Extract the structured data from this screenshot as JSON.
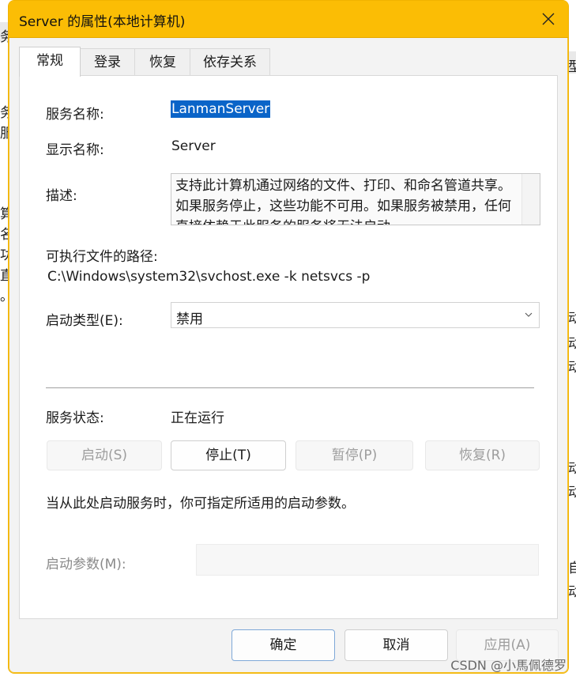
{
  "window": {
    "title": "Server 的属性(本地计算机)",
    "accent_color": "#fbbd05"
  },
  "tabs": [
    {
      "label": "常规",
      "active": true
    },
    {
      "label": "登录",
      "active": false
    },
    {
      "label": "恢复",
      "active": false
    },
    {
      "label": "依存关系",
      "active": false
    }
  ],
  "general": {
    "service_name_label": "服务名称:",
    "service_name_value": "LanmanServer",
    "display_name_label": "显示名称:",
    "display_name_value": "Server",
    "description_label": "描述:",
    "description_text": "支持此计算机通过网络的文件、打印、和命名管道共享。如果服务停止，这些功能不可用。如果服务被禁用，任何直接依赖于此服务的服务将无法启动。",
    "exe_path_label": "可执行文件的路径:",
    "exe_path_value": "C:\\Windows\\system32\\svchost.exe -k netsvcs -p",
    "startup_type_label": "启动类型(E):",
    "startup_type_value": "禁用",
    "service_status_label": "服务状态:",
    "service_status_value": "正在运行",
    "hint_text": "当从此处启动服务时，你可指定所适用的启动参数。",
    "start_params_label": "启动参数(M):"
  },
  "control_buttons": {
    "start": "启动(S)",
    "stop": "停止(T)",
    "pause": "暂停(P)",
    "resume": "恢复(R)"
  },
  "footer_buttons": {
    "ok": "确定",
    "cancel": "取消",
    "apply": "应用(A)"
  },
  "watermark": "CSDN @小馬佩德罗",
  "background_fragments": {
    "left": [
      "务",
      "服",
      "算",
      "名",
      "功",
      "直",
      "。"
    ],
    "right": [
      "型",
      "动",
      "动",
      "动",
      "动",
      "动",
      "自",
      "动"
    ]
  }
}
